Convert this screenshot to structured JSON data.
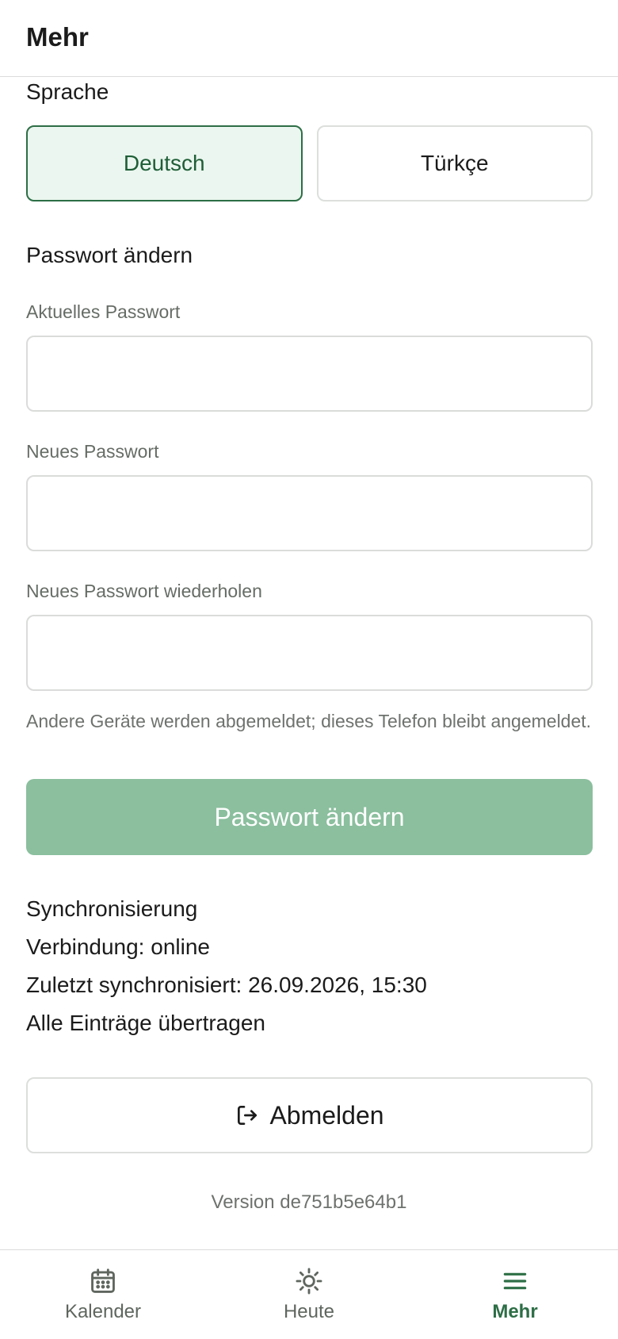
{
  "header": {
    "title": "Mehr"
  },
  "language": {
    "title": "Sprache",
    "options": [
      {
        "label": "Deutsch",
        "selected": true
      },
      {
        "label": "Türkçe",
        "selected": false
      }
    ]
  },
  "password": {
    "title": "Passwort ändern",
    "current_label": "Aktuelles Passwort",
    "current_value": "",
    "new_label": "Neues Passwort",
    "new_value": "",
    "repeat_label": "Neues Passwort wiederholen",
    "repeat_value": "",
    "hint": "Andere Geräte werden abgemeldet; dieses Telefon bleibt angemeldet.",
    "submit_label": "Passwort ändern"
  },
  "sync": {
    "title": "Synchronisierung",
    "connection": "Verbindung: online",
    "last_synced": "Zuletzt synchronisiert: 26.09.2026, 15:30",
    "status": "Alle Einträge übertragen"
  },
  "logout": {
    "label": "Abmelden",
    "icon": "logout-icon"
  },
  "version": "Version de751b5e64b1",
  "nav": {
    "items": [
      {
        "label": "Kalender",
        "icon": "calendar-icon",
        "active": false
      },
      {
        "label": "Heute",
        "icon": "sun-icon",
        "active": false
      },
      {
        "label": "Mehr",
        "icon": "menu-icon",
        "active": true
      }
    ]
  },
  "colors": {
    "accent": "#2d6e46",
    "accent_light": "#eaf6ef",
    "button_disabled": "#8bbf9e",
    "muted_text": "#6e726e"
  }
}
